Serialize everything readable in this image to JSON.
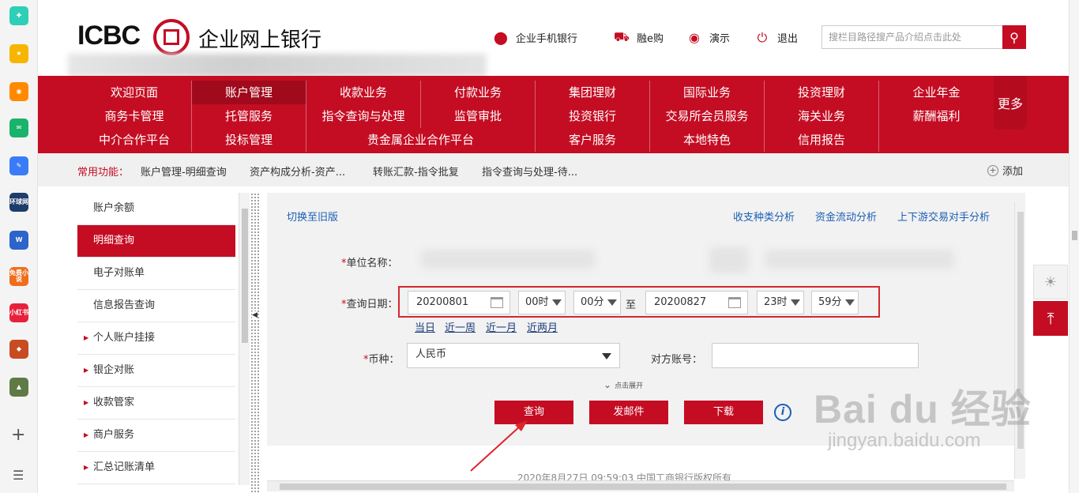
{
  "header": {
    "logo_text": "ICBC",
    "logo_cn": "企业网上银行",
    "links": [
      {
        "label": "企业手机银行",
        "icon": "bank-emblem-icon"
      },
      {
        "label": "融e购",
        "icon": "shopping-cart-icon"
      },
      {
        "label": "演示",
        "icon": "eye-icon"
      },
      {
        "label": "退出",
        "icon": "power-icon"
      }
    ],
    "search_placeholder": "搜栏目路径搜产品介绍点击此处"
  },
  "nav": {
    "rows": [
      [
        "欢迎页面",
        "账户管理",
        "收款业务",
        "付款业务",
        "集团理财",
        "国际业务",
        "投资理财",
        "企业年金"
      ],
      [
        "商务卡管理",
        "托管服务",
        "指令查询与处理",
        "监管审批",
        "投资银行",
        "交易所会员服务",
        "海关业务",
        "薪酬福利"
      ],
      [
        "中介合作平台",
        "投标管理",
        "贵金属企业合作平台",
        "客户服务",
        "本地特色",
        "信用报告"
      ]
    ],
    "active": "账户管理",
    "more": "更多"
  },
  "quickbar": {
    "title": "常用功能：",
    "items": [
      "账户管理-明细查询",
      "资产构成分析-资产...",
      "转账汇款-指令批复",
      "指令查询与处理-待..."
    ],
    "add_label": "添加"
  },
  "sidebar": {
    "items": [
      {
        "label": "账户余额",
        "arrow": false
      },
      {
        "label": "明细查询",
        "arrow": false,
        "active": true
      },
      {
        "label": "电子对账单",
        "arrow": false
      },
      {
        "label": "信息报告查询",
        "arrow": false
      },
      {
        "label": "个人账户挂接",
        "arrow": true
      },
      {
        "label": "银企对账",
        "arrow": true
      },
      {
        "label": "收款管家",
        "arrow": true
      },
      {
        "label": "商户服务",
        "arrow": true
      },
      {
        "label": "汇总记账清单",
        "arrow": true
      }
    ]
  },
  "main": {
    "switch_old": "切换至旧版",
    "top_links": [
      "收支种类分析",
      "资金流动分析",
      "上下游交易对手分析"
    ],
    "unit_label": "单位名称：",
    "date_label": "查询日期：",
    "date_from": "20200801",
    "hour_from": "00时",
    "min_from": "00分",
    "to_label": "至",
    "date_to": "20200827",
    "hour_to": "23时",
    "min_to": "59分",
    "quick_dates": [
      "当日",
      "近一周",
      "近一月",
      "近两月"
    ],
    "currency_label": "币种：",
    "currency_value": "人民币",
    "counter_account_label": "对方账号：",
    "expand_label": "点击展开",
    "buttons": {
      "query": "查询",
      "email": "发邮件",
      "download": "下载"
    },
    "info_icon_glyph": "i",
    "footer": "2020年8月27日 09:59:03   中国工商银行版权所有"
  },
  "browser_sidebar": {
    "apps": [
      {
        "name": "plus-app-icon",
        "color": "#2ecfb6",
        "label": "✚"
      },
      {
        "name": "star-app-icon",
        "color": "#f7b500",
        "label": "★"
      },
      {
        "name": "weibo-icon",
        "color": "#ff8a00",
        "label": "◉"
      },
      {
        "name": "mail-app-icon",
        "color": "#19b36b",
        "label": "✉"
      },
      {
        "name": "notes-app-icon",
        "color": "#3a7bf7",
        "label": "✎"
      },
      {
        "name": "huanqiu-app-icon",
        "color": "#1d3d6b",
        "label": "环球网"
      },
      {
        "name": "word-app-icon",
        "color": "#2c64c9",
        "label": "W"
      },
      {
        "name": "novel-app-icon",
        "color": "#f06e1c",
        "label": "免费小说"
      },
      {
        "name": "xiaohongshu-icon",
        "color": "#e8213b",
        "label": "小红书"
      },
      {
        "name": "game-app-icon-1",
        "color": "#c84b21",
        "label": "◆"
      },
      {
        "name": "game-app-icon-2",
        "color": "#5e7a45",
        "label": "▲"
      }
    ]
  },
  "watermark": {
    "big": "Bai du 经验",
    "small": "jingyan.baidu.com"
  }
}
